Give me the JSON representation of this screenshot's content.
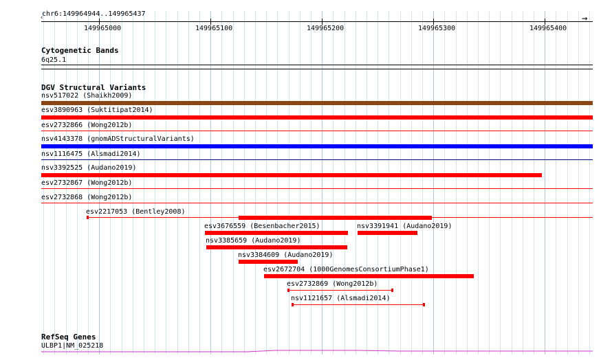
{
  "ruler": {
    "region": "chr6:149964944..149965437",
    "ticks": [
      "149965000",
      "149965100",
      "149965200",
      "149965300",
      "149965400"
    ]
  },
  "cytoband": {
    "title": "Cytogenetic Bands",
    "band": "6q25.1"
  },
  "dgv": {
    "title": "DGV Structural Variants",
    "features": [
      {
        "label": "nsv517022 (Shaikh2009)",
        "color": "#8b4513"
      },
      {
        "label": "esv3890963 (Suktitipat2014)",
        "color": "#ff0000"
      },
      {
        "label": "esv2732866 (Wong2012b)",
        "color": "#ff0000"
      },
      {
        "label": "nsv4143378 (gnomADStructuralVariants)",
        "color": "#0000ff"
      },
      {
        "label": "nsv1116475 (Alsmadi2014)",
        "color": "#ff0000"
      },
      {
        "label": "nsv3392525 (Audano2019)",
        "color": "#ff0000"
      },
      {
        "label": "esv2732867 (Wong2012b)",
        "color": "#ff0000"
      },
      {
        "label": "esv2732868 (Wong2012b)",
        "color": "#ff0000"
      },
      {
        "label": "esv2217053 (Bentley2008)",
        "color": "#ff0000"
      },
      {
        "label": "esv3676559 (Besenbacher2015)",
        "color": "#ff0000"
      },
      {
        "label": "nsv3391941 (Audano2019)",
        "color": "#ff0000"
      },
      {
        "label": "nsv3385659 (Audano2019)",
        "color": "#ff0000"
      },
      {
        "label": "nsv3384609 (Audano2019)",
        "color": "#ff0000"
      },
      {
        "label": "esv2672704 (1000GenomesConsortiumPhase1)",
        "color": "#ff0000"
      },
      {
        "label": "esv2732869 (Wong2012b)",
        "color": "#ff0000"
      },
      {
        "label": "nsv1121657 (Alsmadi2014)",
        "color": "#ff0000"
      }
    ]
  },
  "refseq": {
    "title": "RefSeq Genes",
    "gene": "ULBP1|NM_025218",
    "color": "#cc33cc"
  }
}
